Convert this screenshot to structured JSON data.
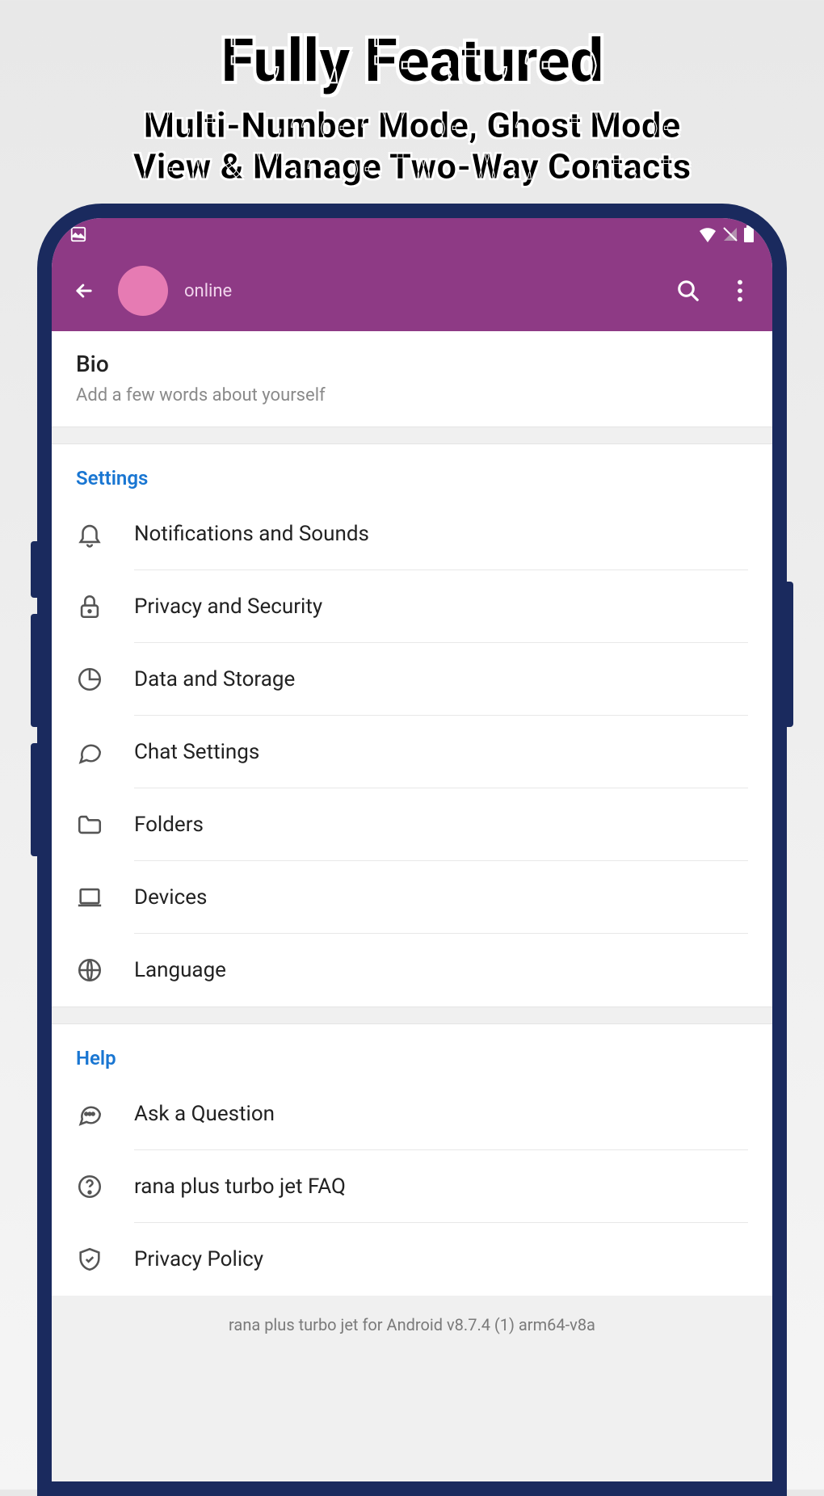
{
  "promo": {
    "title": "Fully Featured",
    "subtitle_line1": "Multi-Number Mode, Ghost Mode",
    "subtitle_line2": "View & Manage Two-Way Contacts"
  },
  "header": {
    "presence": "online"
  },
  "bio": {
    "title": "Bio",
    "subtitle": "Add a few words about yourself"
  },
  "settings": {
    "header": "Settings",
    "items": [
      {
        "label": "Notifications and Sounds"
      },
      {
        "label": "Privacy and Security"
      },
      {
        "label": "Data and Storage"
      },
      {
        "label": "Chat Settings"
      },
      {
        "label": "Folders"
      },
      {
        "label": "Devices"
      },
      {
        "label": "Language"
      }
    ]
  },
  "help": {
    "header": "Help",
    "items": [
      {
        "label": "Ask a Question"
      },
      {
        "label": "rana plus turbo jet FAQ"
      },
      {
        "label": "Privacy Policy"
      }
    ]
  },
  "footer": {
    "text": "rana plus turbo jet for Android v8.7.4 (1) arm64-v8a"
  }
}
